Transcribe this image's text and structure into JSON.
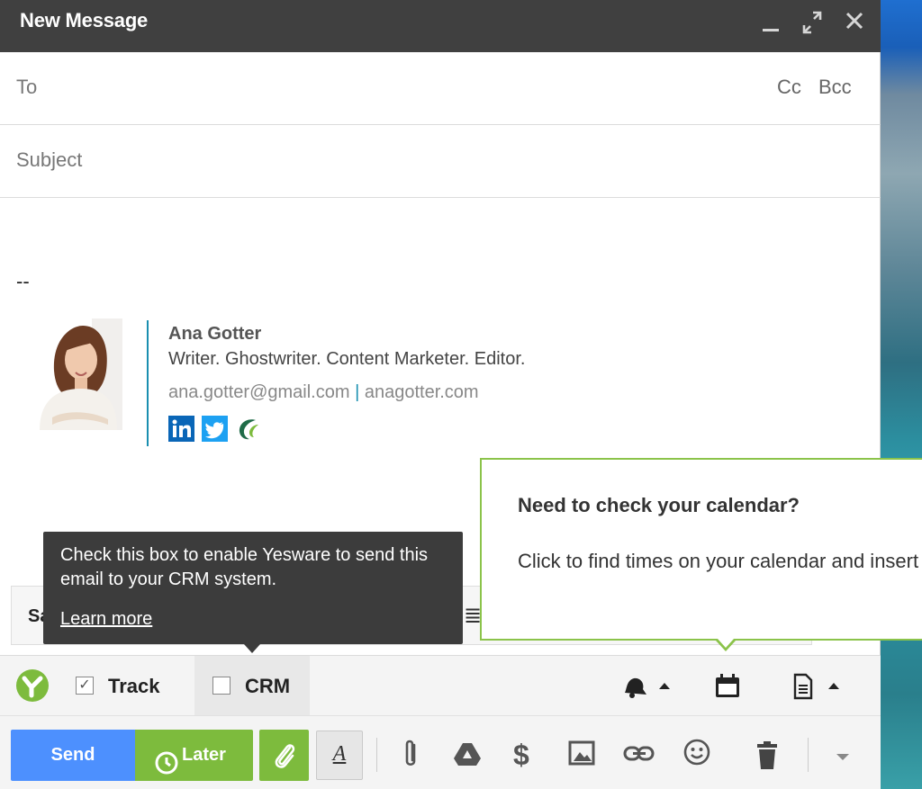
{
  "window": {
    "title": "New Message"
  },
  "recipients": {
    "to_label": "To",
    "cc_label": "Cc",
    "bcc_label": "Bcc",
    "subject_placeholder": "Subject"
  },
  "body": {
    "separator": "--",
    "signature": {
      "name": "Ana Gotter",
      "role": "Writer. Ghostwriter. Content Marketer. Editor.",
      "email": "ana.gotter@gmail.com",
      "link_separator": "|",
      "website": "anagotter.com",
      "social": [
        "linkedin-icon",
        "twitter-icon",
        "ghostwriter-logo-icon"
      ]
    }
  },
  "crm_tooltip": {
    "text": "Check this box to enable Yesware to send this email to your CRM system.",
    "link": "Learn more"
  },
  "calendar_tooltip": {
    "heading": "Need to check your calendar?",
    "body": "Click to find times on your calendar and insert them without any typing."
  },
  "background_panel": {
    "partial_text": "Sa"
  },
  "yesware_toolbar": {
    "track_label": "Track",
    "track_checked": true,
    "crm_label": "CRM",
    "crm_checked": false
  },
  "actions": {
    "send_label": "Send",
    "later_label": "Later"
  },
  "colors": {
    "titlebar": "#404040",
    "send": "#4d90fe",
    "later": "#7dbb3d",
    "tooltip_border": "#8bc34a",
    "signature_accent": "#1a8fb0"
  }
}
